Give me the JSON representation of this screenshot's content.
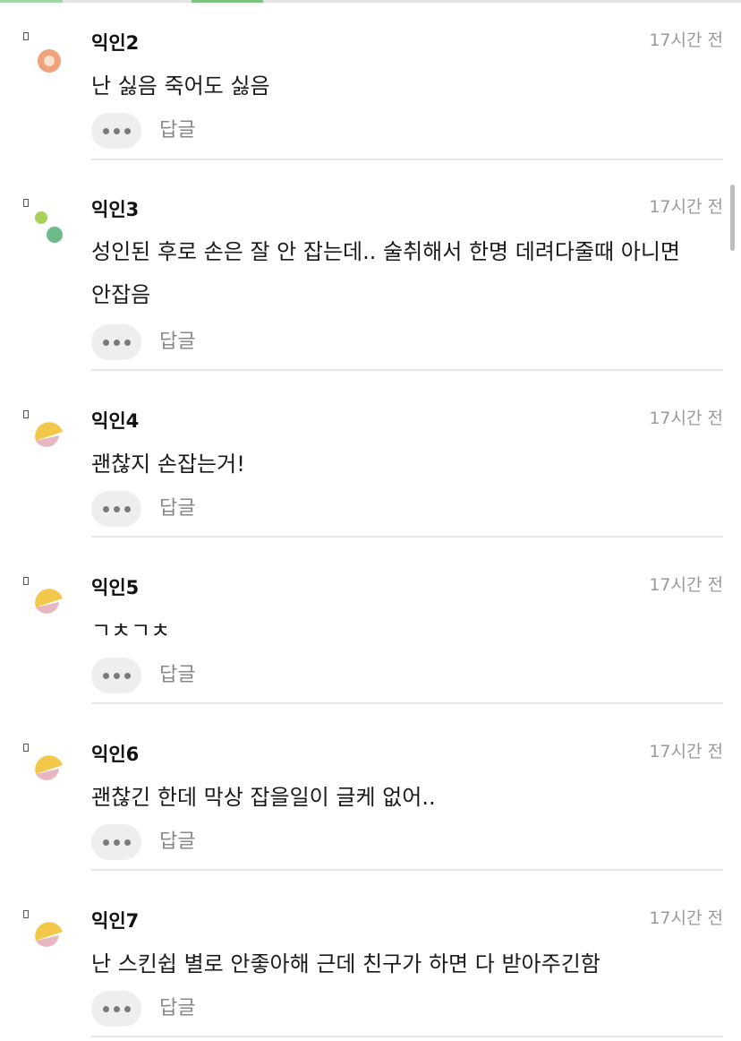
{
  "colors": {
    "green_accent": "#7bc47f",
    "avatar_orange": "#f0a37a",
    "avatar_orange_inner": "#fbe1cf",
    "avatar_lime": "#a8d15a",
    "avatar_green": "#6dbb8a",
    "avatar_yellow": "#f2c84b",
    "avatar_pink": "#e8b6c0"
  },
  "icons": {
    "avatar_2": "orange-ring-avatar-icon",
    "avatar_3": "green-dots-avatar-icon",
    "avatar_4_7": "yellow-pink-halves-avatar-icon",
    "more": "more-dots-icon"
  },
  "comments": [
    {
      "author": "익인2",
      "time": "17시간 전",
      "text": "난 싫음 죽어도 싫음",
      "more_label": "•••",
      "reply_label": "답글"
    },
    {
      "author": "익인3",
      "time": "17시간 전",
      "text": "성인된 후로 손은 잘 안 잡는데.. 술취해서 한명 데려다줄때 아니면 안잡음",
      "more_label": "•••",
      "reply_label": "답글"
    },
    {
      "author": "익인4",
      "time": "17시간 전",
      "text": "괜찮지 손잡는거!",
      "more_label": "•••",
      "reply_label": "답글"
    },
    {
      "author": "익인5",
      "time": "17시간 전",
      "text": "ㄱㅊㄱㅊ",
      "more_label": "•••",
      "reply_label": "답글"
    },
    {
      "author": "익인6",
      "time": "17시간 전",
      "text": "괜찮긴 한데 막상 잡을일이 글케 없어..",
      "more_label": "•••",
      "reply_label": "답글"
    },
    {
      "author": "익인7",
      "time": "17시간 전",
      "text": "난 스킨쉽 별로 안좋아해 근데 친구가 하면 다 받아주긴함",
      "more_label": "•••",
      "reply_label": "답글"
    }
  ]
}
